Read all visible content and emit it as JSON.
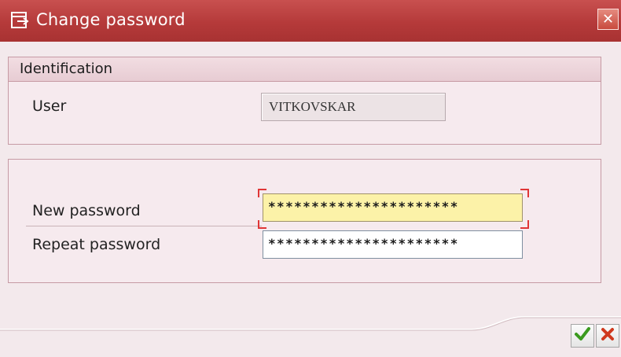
{
  "window": {
    "title": "Change password",
    "title_icon": "dialog-window-icon",
    "close_icon": "close-icon"
  },
  "identification": {
    "header": "Identification",
    "user_label": "User",
    "user_value": "VITKOVSKAR"
  },
  "password": {
    "new_label": "New password",
    "new_value": "**********************",
    "repeat_label": "Repeat password",
    "repeat_value": "**********************"
  },
  "footer": {
    "confirm_icon": "checkmark-icon",
    "cancel_icon": "cancel-icon"
  },
  "colors": {
    "titlebar": "#b53a3a",
    "focused_field": "#fcf2a8",
    "confirm": "#3a9a1e",
    "cancel": "#d0391e"
  }
}
